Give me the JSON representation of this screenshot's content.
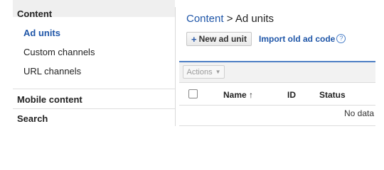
{
  "sidebar": {
    "section_title": "Content",
    "items": [
      {
        "label": "Ad units",
        "active": true
      },
      {
        "label": "Custom channels",
        "active": false
      },
      {
        "label": "URL channels",
        "active": false
      }
    ],
    "sections": [
      {
        "label": "Mobile content"
      },
      {
        "label": "Search"
      }
    ]
  },
  "breadcrumb": {
    "root": "Content",
    "separator": " > ",
    "current": "Ad units"
  },
  "toolbar": {
    "new_ad_unit_label": "New ad unit",
    "new_icon": "plus-icon",
    "import_label": "Import old ad code",
    "help_icon": "help-icon",
    "actions_label": "Actions"
  },
  "table": {
    "columns": [
      "Name",
      "ID",
      "Status"
    ],
    "sort_icon": "sort-up-arrow-icon",
    "empty_text": "No data"
  },
  "colors": {
    "link": "#1f56a8",
    "accent_line": "#4d7ec4",
    "sidebar_header_bg": "#efefef"
  }
}
